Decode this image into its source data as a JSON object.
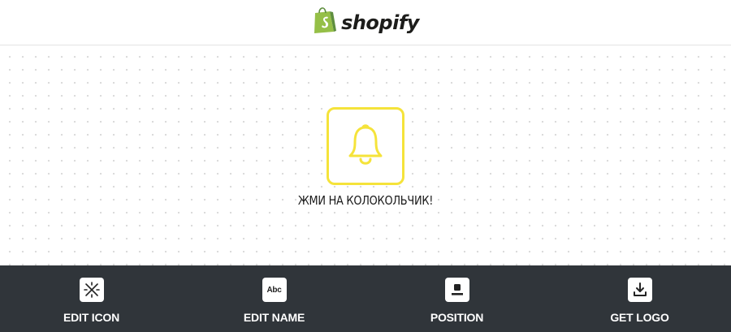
{
  "header": {
    "brand_name": "shopify",
    "brand_color": "#95bf47"
  },
  "preview": {
    "icon": "bell-icon",
    "icon_color": "#f5e33a",
    "name": "ЖМИ НА КОЛОКОЛЬЧИК!"
  },
  "toolbar": {
    "background": "#30353a",
    "edit_icon": {
      "label": "EDIT ICON",
      "icon": "magic-wand-icon"
    },
    "edit_name": {
      "label": "EDIT NAME",
      "icon": "abc-text-icon",
      "icon_text": "Abc"
    },
    "position": {
      "label": "POSITION",
      "icon": "position-layout-icon"
    },
    "get_logo": {
      "label": "GET LOGO",
      "icon": "download-icon"
    }
  }
}
